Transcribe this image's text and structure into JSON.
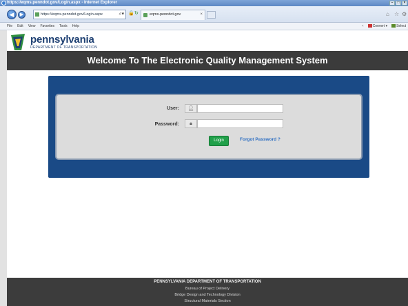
{
  "browser": {
    "window_title": "https://eqms.penndot.gov/Login.aspx - Internet Explorer",
    "address": "https://eqms.penndot.gov/Login.aspx",
    "tab_title": "eqms.penndot.gov",
    "menus": [
      "File",
      "Edit",
      "View",
      "Favorites",
      "Tools",
      "Help"
    ],
    "convert_label": "Convert",
    "select_label": "Select"
  },
  "logo": {
    "title": "pennsylvania",
    "subtitle": "DEPARTMENT OF TRANSPORTATION"
  },
  "banner": {
    "text": "Welcome To The Electronic Quality Management System"
  },
  "login": {
    "user_label": "User:",
    "user_value": "",
    "password_label": "Password:",
    "password_value": "",
    "login_button": "Login",
    "forgot_link": "Forgot Password ?"
  },
  "footer": {
    "line1": "PENNSYLVANIA DEPARTMENT OF TRANSPORTATION",
    "line2": "Bureau of Project Delivery",
    "line3": "Bridge Design and Technology Division",
    "line4": "Structural Materials Section"
  },
  "colors": {
    "banner_bg": "#3b3b3b",
    "card_bg": "#1a4a86",
    "login_button": "#21a04a",
    "link": "#2e6fc2",
    "logo_text": "#1d3f72"
  }
}
